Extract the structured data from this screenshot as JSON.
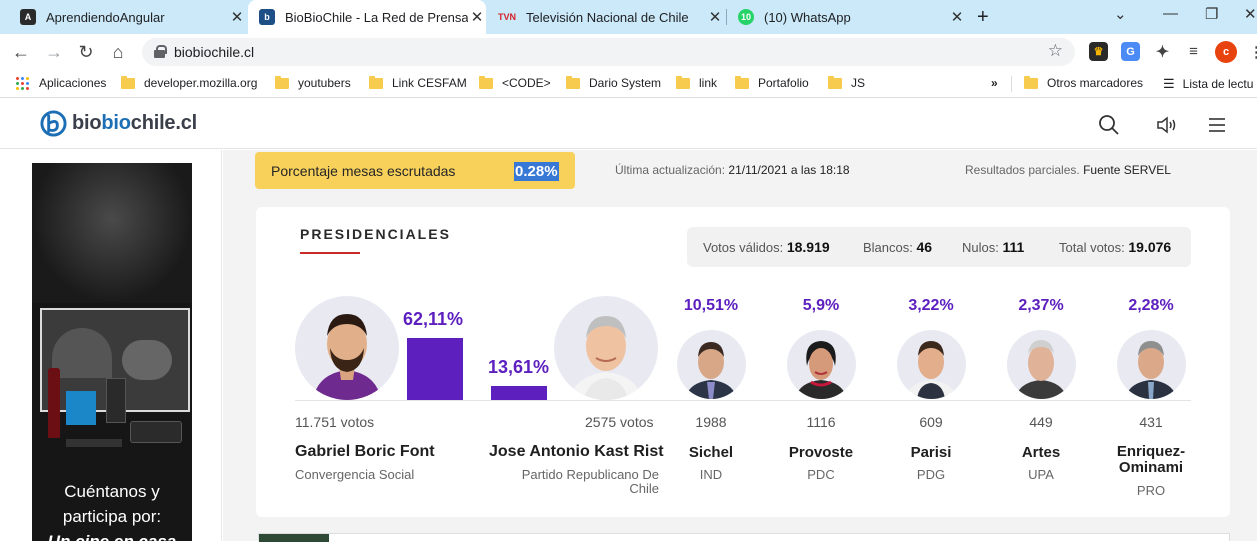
{
  "browser": {
    "tabs": [
      {
        "title": "AprendiendoAngular",
        "favicon": "angular-icon",
        "active": false
      },
      {
        "title": "BioBioChile - La Red de Prensa M",
        "favicon": "biobio-icon",
        "active": true
      },
      {
        "title": "Televisión Nacional de Chile",
        "favicon": "tvn-icon",
        "active": false
      },
      {
        "title": "(10) WhatsApp",
        "favicon": "whatsapp-icon",
        "active": false
      }
    ],
    "url": "biobiochile.cl",
    "profile_initial": "c",
    "whatsapp_badge": "10",
    "bookmarks": {
      "apps": "Aplicaciones",
      "items": [
        "developer.mozilla.org",
        "youtubers",
        "Link CESFAM",
        "<CODE>",
        "Dario System",
        "link",
        "Portafolio",
        "JS"
      ],
      "overflow": "»",
      "other": "Otros marcadores",
      "reading_list": "Lista de lectu"
    },
    "colors": {
      "tabstrip": "#cbe9f9",
      "accent": "#1d6fb5"
    }
  },
  "site": {
    "logo": {
      "part1": "bio",
      "part2": "bio",
      "part3": "chile.cl"
    }
  },
  "ad": {
    "line1": "Cuéntanos y",
    "line2": "participa por:",
    "line3": "Un cine en casa"
  },
  "results": {
    "pct_label": "Porcentaje mesas escrutadas",
    "pct_value": "0.28%",
    "updated_label": "Última actualización:",
    "updated_value": "21/11/2021 a las 18:18",
    "partial_label": "Resultados parciales.",
    "partial_source": "Fuente SERVEL",
    "section_title": "PRESIDENCIALES",
    "totals": {
      "valid_label": "Votos válidos:",
      "valid": "18.919",
      "blank_label": "Blancos:",
      "blank": "46",
      "null_label": "Nulos:",
      "null": "111",
      "total_label": "Total votos:",
      "total": "19.076"
    },
    "candidates": [
      {
        "name": "Gabriel Boric Font",
        "party": "Convergencia Social",
        "pct": "62,11%",
        "pct_value": 62.11,
        "votes": "11.751 votos"
      },
      {
        "name": "Jose Antonio Kast Rist",
        "party": "Partido Republicano De Chile",
        "pct": "13,61%",
        "pct_value": 13.61,
        "votes": "2575 votos"
      },
      {
        "name": "Sichel",
        "party": "IND",
        "pct": "10,51%",
        "votes": "1988"
      },
      {
        "name": "Provoste",
        "party": "PDC",
        "pct": "5,9%",
        "votes": "1116"
      },
      {
        "name": "Parisi",
        "party": "PDG",
        "pct": "3,22%",
        "votes": "609"
      },
      {
        "name": "Artes",
        "party": "UPA",
        "pct": "2,37%",
        "votes": "449"
      },
      {
        "name": "Enriquez-Ominami",
        "party": "PRO",
        "pct": "2,28%",
        "votes": "431"
      }
    ],
    "bar_color": "#5d20bf",
    "highlight_color": "#f7d15a"
  }
}
